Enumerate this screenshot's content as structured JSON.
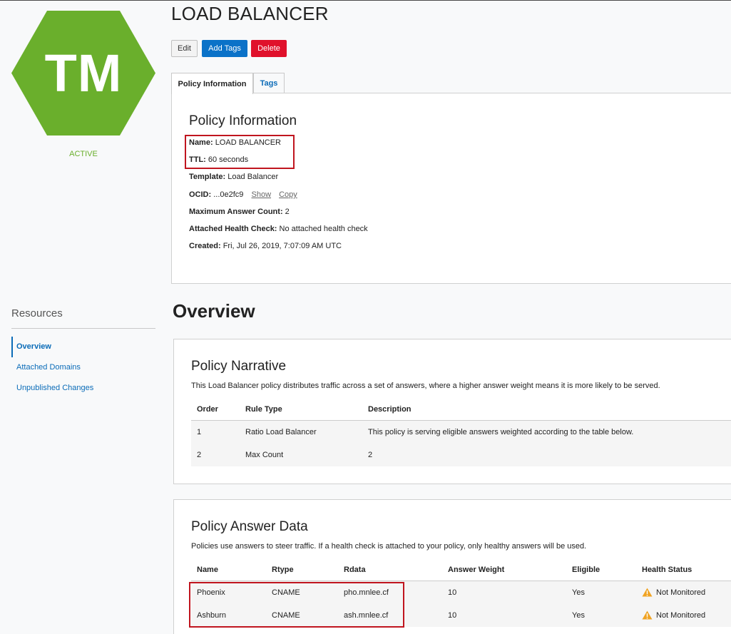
{
  "page": {
    "title": "LOAD BALANCER"
  },
  "badge": {
    "initials": "TM",
    "status": "ACTIVE",
    "color": "#6aaf2c"
  },
  "actions": {
    "edit": "Edit",
    "add_tags": "Add Tags",
    "delete": "Delete"
  },
  "tabs": [
    {
      "label": "Policy Information"
    },
    {
      "label": "Tags"
    }
  ],
  "policy_info": {
    "heading": "Policy Information",
    "name_label": "Name:",
    "name_value": "LOAD BALANCER",
    "ttl_label": "TTL:",
    "ttl_value": "60 seconds",
    "template_label": "Template:",
    "template_value": "Load Balancer",
    "ocid_label": "OCID:",
    "ocid_value": "...0e2fc9",
    "ocid_show": "Show",
    "ocid_copy": "Copy",
    "max_label": "Maximum Answer Count:",
    "max_value": "2",
    "health_label": "Attached Health Check:",
    "health_value": "No attached health check",
    "created_label": "Created:",
    "created_value": "Fri, Jul 26, 2019, 7:07:09 AM UTC"
  },
  "resources": {
    "title": "Resources",
    "items": [
      {
        "label": "Overview"
      },
      {
        "label": "Attached Domains"
      },
      {
        "label": "Unpublished Changes"
      }
    ]
  },
  "overview": {
    "title": "Overview"
  },
  "narrative": {
    "heading": "Policy Narrative",
    "description": "This Load Balancer policy distributes traffic across a set of answers, where a higher answer weight means it is more likely to be served.",
    "columns": [
      "Order",
      "Rule Type",
      "Description"
    ],
    "rows": [
      [
        "1",
        "Ratio Load Balancer",
        "This policy is serving eligible answers weighted according to the table below."
      ],
      [
        "2",
        "Max Count",
        "2"
      ]
    ]
  },
  "answers": {
    "heading": "Policy Answer Data",
    "description": "Policies use answers to steer traffic. If a health check is attached to your policy, only healthy answers will be used.",
    "columns": [
      "Name",
      "Rtype",
      "Rdata",
      "Answer Weight",
      "Eligible",
      "Health Status"
    ],
    "rows": [
      [
        "Phoenix",
        "CNAME",
        "pho.mnlee.cf",
        "10",
        "Yes",
        "Not Monitored"
      ],
      [
        "Ashburn",
        "CNAME",
        "ash.mnlee.cf",
        "10",
        "Yes",
        "Not Monitored"
      ]
    ]
  },
  "colors": {
    "primary": "#0b72c8",
    "danger": "#e0112b",
    "highlight": "#c0151f",
    "warning": "#f0a322"
  }
}
